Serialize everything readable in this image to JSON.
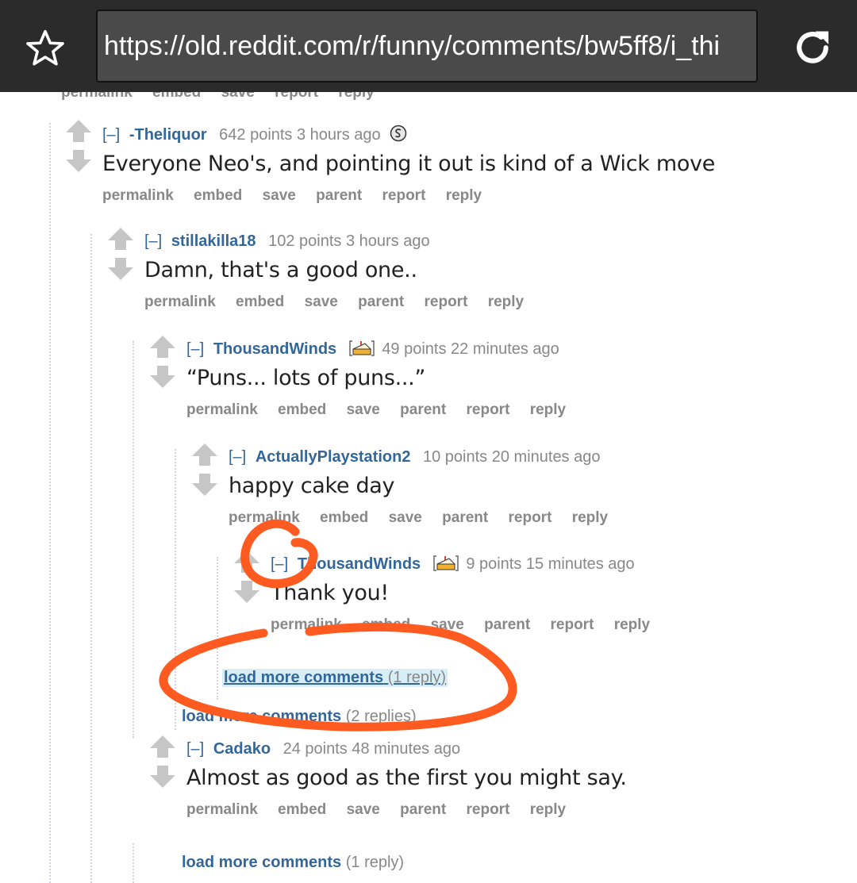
{
  "browser": {
    "url": "https://old.reddit.com/r/funny/comments/bw5ff8/i_thi",
    "star_icon": "star-outline-icon",
    "reload_icon": "reload-icon"
  },
  "partial_links": [
    "permalink",
    "embed",
    "save",
    "report",
    "reply"
  ],
  "colors": {
    "topbar": "#2b2b2b",
    "link_blue": "#336699",
    "annotation": "#ff5a1f"
  },
  "comments": [
    {
      "collapse": "[–]",
      "author": "-Theliquor",
      "meta": "642 points 3 hours ago",
      "body": "Everyone Neo's, and pointing it out is kind of a Wick move",
      "buttons": [
        "permalink",
        "embed",
        "save",
        "parent",
        "report",
        "reply"
      ]
    },
    {
      "collapse": "[–]",
      "author": "stillakilla18",
      "meta": "102 points 3 hours ago",
      "body": "Damn, that's a good one..",
      "buttons": [
        "permalink",
        "embed",
        "save",
        "parent",
        "report",
        "reply"
      ]
    },
    {
      "collapse": "[–]",
      "author": "ThousandWinds",
      "meta": "49 points 22 minutes ago",
      "body": "“Puns... lots of puns...”",
      "buttons": [
        "permalink",
        "embed",
        "save",
        "parent",
        "report",
        "reply"
      ]
    },
    {
      "collapse": "[–]",
      "author": "ActuallyPlaystation2",
      "meta": "10 points 20 minutes ago",
      "body": "happy cake day",
      "buttons": [
        "permalink",
        "embed",
        "save",
        "parent",
        "report",
        "reply"
      ]
    },
    {
      "collapse": "[–]",
      "author": "ThousandWinds",
      "meta": "9 points 15 minutes ago",
      "body": "Thank you!",
      "buttons": [
        "permalink",
        "embed",
        "save",
        "parent",
        "report",
        "reply"
      ]
    },
    {
      "collapse": "[–]",
      "author": "Cadako",
      "meta": "24 points 48 minutes ago",
      "body": "Almost as good as the first you might say.",
      "buttons": [
        "permalink",
        "embed",
        "save",
        "parent",
        "report",
        "reply"
      ]
    }
  ],
  "load_more": [
    {
      "link": "load more comments",
      "count": "(1 reply)"
    },
    {
      "link": "load more comments",
      "count": "(2 replies)"
    },
    {
      "link": "load more comments",
      "count": "(1 reply)"
    }
  ]
}
